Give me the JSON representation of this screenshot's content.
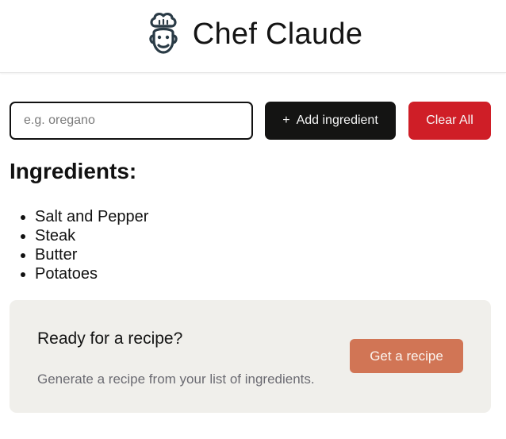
{
  "header": {
    "title": "Chef Claude",
    "logo_icon": "chef-face-icon"
  },
  "form": {
    "input_placeholder": "e.g. oregano",
    "input_value": "",
    "add_button_icon": "+",
    "add_button_label": "Add ingredient",
    "clear_button_label": "Clear All"
  },
  "ingredients": {
    "title": "Ingredients:",
    "items": [
      "Salt and Pepper",
      "Steak",
      "Butter",
      "Potatoes"
    ]
  },
  "recipe_card": {
    "heading": "Ready for a recipe?",
    "description": "Generate a recipe from your list of ingredients.",
    "button_label": "Get a recipe"
  },
  "colors": {
    "add_button_bg": "#141413",
    "clear_button_bg": "#cf1e27",
    "recipe_button_bg": "#d17555",
    "card_bg": "#f0efeb"
  }
}
